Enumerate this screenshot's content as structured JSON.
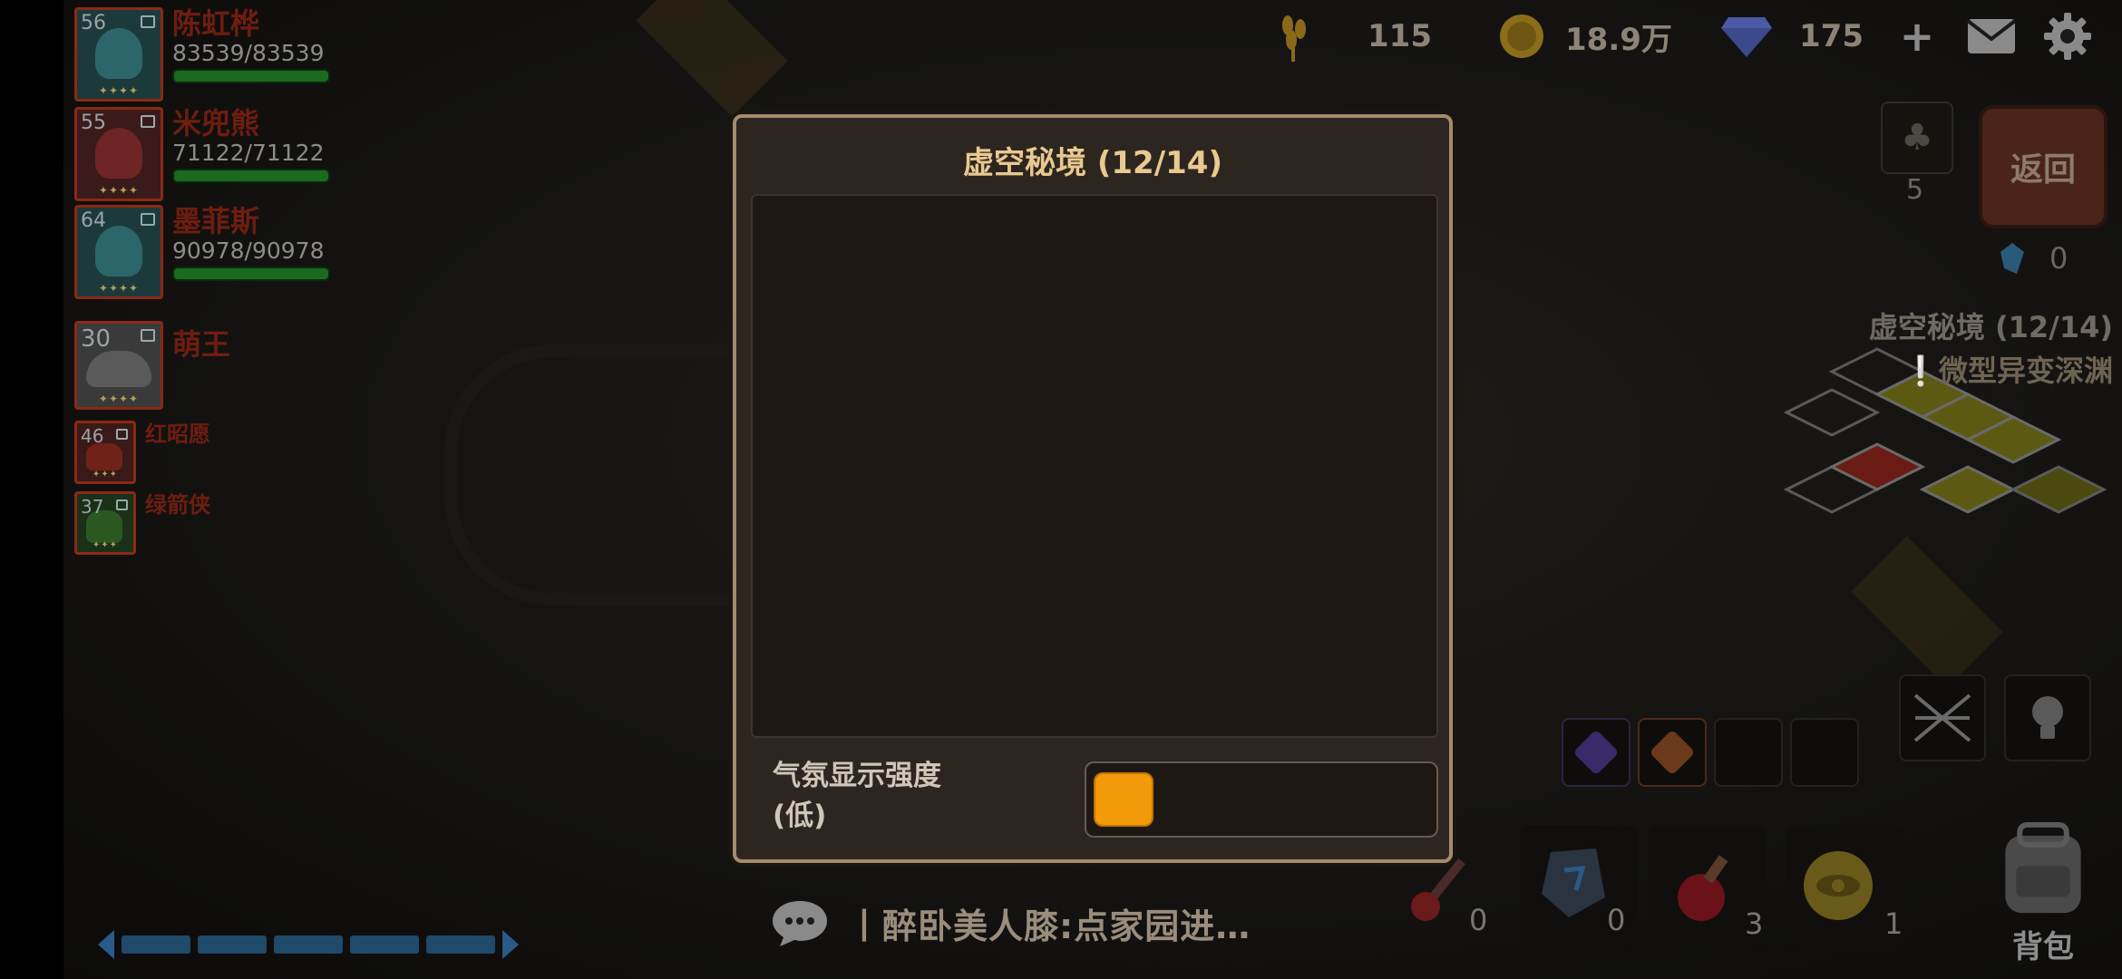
{
  "resources": [
    {
      "name": "wheat",
      "icon": "wheat-icon",
      "value": "115"
    },
    {
      "name": "gold",
      "icon": "gold-coin-icon",
      "value": "18.9万"
    },
    {
      "name": "diamond",
      "icon": "diamond-icon",
      "value": "175"
    }
  ],
  "party": [
    {
      "level": "56",
      "name": "陈虹桦",
      "hp": "83539/83539",
      "hp_fraction": 1.0
    },
    {
      "level": "55",
      "name": "米兜熊",
      "hp": "71122/71122",
      "hp_fraction": 1.0
    },
    {
      "level": "64",
      "name": "墨菲斯",
      "hp": "90978/90978",
      "hp_fraction": 1.0
    },
    {
      "level": "30",
      "name": "萌王"
    },
    {
      "level": "46",
      "name": "红昭愿"
    },
    {
      "level": "37",
      "name": "绿箭侠"
    }
  ],
  "sidebar": {
    "clover_count": "5",
    "return_label": "返回",
    "crystal_count": "0",
    "stage_title": "虚空秘境 (12/14)",
    "stage_sub": "微型异变深渊"
  },
  "dialog": {
    "title": "虚空秘境 (12/14)",
    "setting_label": "气氛显示强度",
    "setting_value": "(低)",
    "slider_level": 0.0
  },
  "items": [
    {
      "icon": "red-potion-icon",
      "count": "0"
    },
    {
      "icon": "rune-stone-icon",
      "count": "0"
    },
    {
      "icon": "red-flask-icon",
      "count": "3"
    },
    {
      "icon": "golden-eye-icon",
      "count": "1"
    }
  ],
  "chat": {
    "text": "丨醉卧美人膝:点家园进…"
  },
  "bag_label": "背包",
  "colors": {
    "accent": "#f39a0a",
    "dialog_border": "#a58b6c",
    "title": "#e8c98f"
  }
}
